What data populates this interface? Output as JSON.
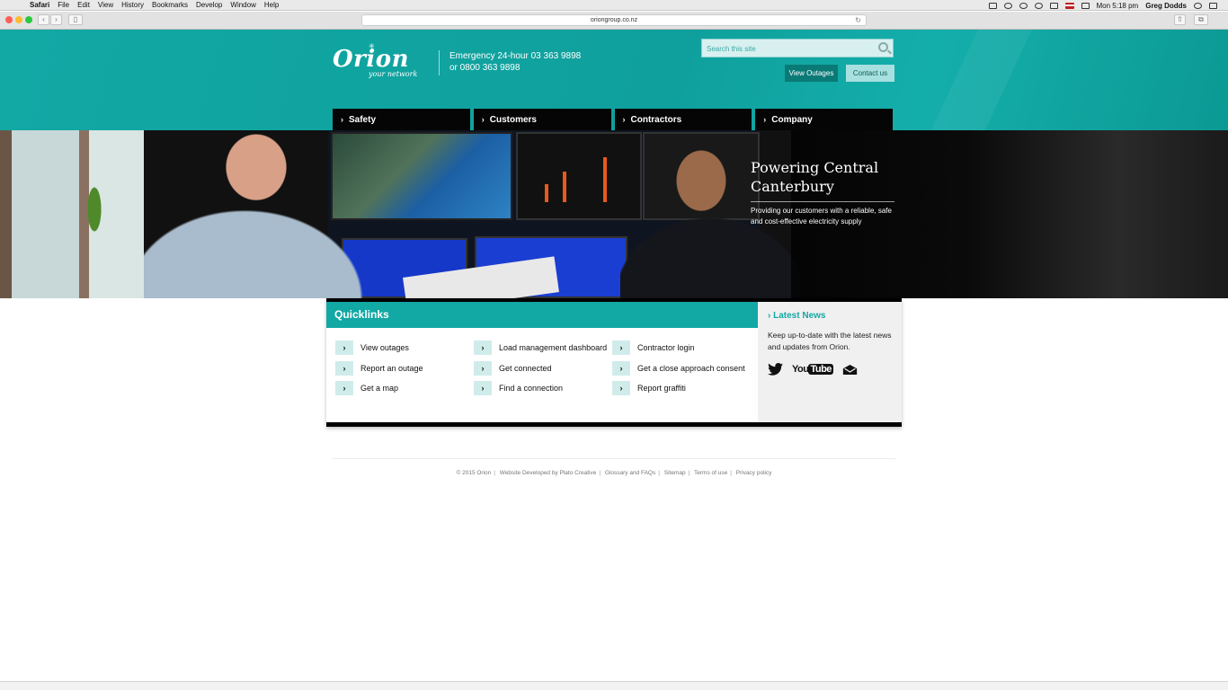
{
  "menubar": {
    "app": "Safari",
    "items": [
      "File",
      "Edit",
      "View",
      "History",
      "Bookmarks",
      "Develop",
      "Window",
      "Help"
    ],
    "clock": "Mon 5:18 pm",
    "user": "Greg Dodds"
  },
  "browser": {
    "url": "oriongroup.co.nz"
  },
  "header": {
    "logo_name": "Orion",
    "logo_tag": "your network",
    "emergency_line1": "Emergency 24-hour 03 363 9898",
    "emergency_line2": "or 0800 363 9898",
    "search_placeholder": "Search this site",
    "view_outages": "View Outages",
    "contact_us": "Contact us",
    "accent_color": "#12a8a4"
  },
  "nav": [
    {
      "label": "Safety"
    },
    {
      "label": "Customers"
    },
    {
      "label": "Contractors"
    },
    {
      "label": "Company"
    }
  ],
  "hero": {
    "title": "Powering Central Canterbury",
    "subtitle": "Providing our customers with a reliable, safe and cost-effective electricity supply"
  },
  "quicklinks": {
    "title": "Quicklinks",
    "col1": [
      "View outages",
      "Report an outage",
      "Get a map"
    ],
    "col2": [
      "Load management dashboard",
      "Get connected",
      "Find a connection"
    ],
    "col3": [
      "Contractor login",
      "Get a close approach consent",
      "Report graffiti"
    ]
  },
  "news": {
    "title": "Latest News",
    "text": "Keep up-to-date with the latest news and updates from Orion.",
    "youtube_you": "You",
    "youtube_tube": "Tube"
  },
  "footer": {
    "copyright": "© 2015 Orion",
    "credit": "Website Developed by Plato Creative",
    "glossary": "Glossary and FAQs",
    "sitemap": "Sitemap",
    "terms": "Terms of use",
    "privacy": "Privacy policy"
  }
}
